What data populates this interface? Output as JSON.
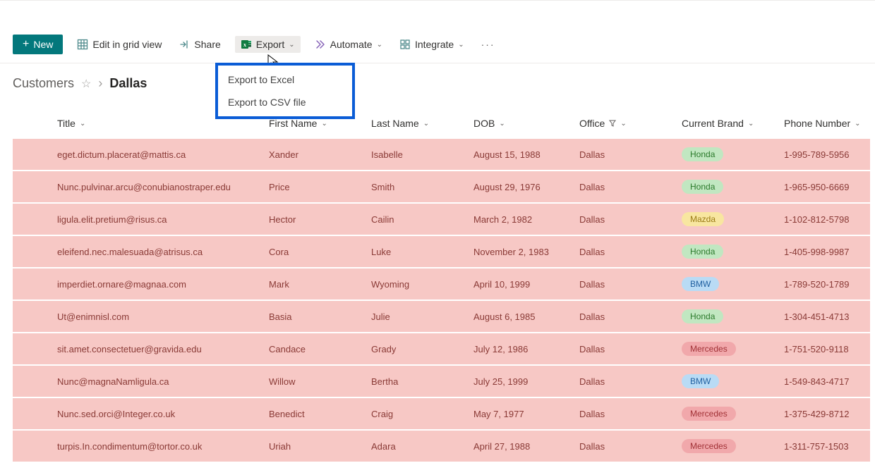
{
  "toolbar": {
    "new_label": "New",
    "edit_grid_label": "Edit in grid view",
    "share_label": "Share",
    "export_label": "Export",
    "automate_label": "Automate",
    "integrate_label": "Integrate"
  },
  "export_menu": {
    "items": [
      {
        "label": "Export to Excel"
      },
      {
        "label": "Export to CSV file"
      }
    ]
  },
  "breadcrumb": {
    "root": "Customers",
    "current": "Dallas"
  },
  "columns": {
    "title": "Title",
    "first_name": "First Name",
    "last_name": "Last Name",
    "dob": "DOB",
    "office": "Office",
    "brand": "Current Brand",
    "phone": "Phone Number"
  },
  "brand_styles": {
    "Honda": "brand-honda",
    "Mazda": "brand-mazda",
    "BMW": "brand-bmw",
    "Mercedes": "brand-mercedes"
  },
  "rows": [
    {
      "title": "eget.dictum.placerat@mattis.ca",
      "first_name": "Xander",
      "last_name": "Isabelle",
      "dob": "August 15, 1988",
      "office": "Dallas",
      "brand": "Honda",
      "phone": "1-995-789-5956"
    },
    {
      "title": "Nunc.pulvinar.arcu@conubianostraper.edu",
      "first_name": "Price",
      "last_name": "Smith",
      "dob": "August 29, 1976",
      "office": "Dallas",
      "brand": "Honda",
      "phone": "1-965-950-6669"
    },
    {
      "title": "ligula.elit.pretium@risus.ca",
      "first_name": "Hector",
      "last_name": "Cailin",
      "dob": "March 2, 1982",
      "office": "Dallas",
      "brand": "Mazda",
      "phone": "1-102-812-5798"
    },
    {
      "title": "eleifend.nec.malesuada@atrisus.ca",
      "first_name": "Cora",
      "last_name": "Luke",
      "dob": "November 2, 1983",
      "office": "Dallas",
      "brand": "Honda",
      "phone": "1-405-998-9987"
    },
    {
      "title": "imperdiet.ornare@magnaa.com",
      "first_name": "Mark",
      "last_name": "Wyoming",
      "dob": "April 10, 1999",
      "office": "Dallas",
      "brand": "BMW",
      "phone": "1-789-520-1789"
    },
    {
      "title": "Ut@enimnisl.com",
      "first_name": "Basia",
      "last_name": "Julie",
      "dob": "August 6, 1985",
      "office": "Dallas",
      "brand": "Honda",
      "phone": "1-304-451-4713"
    },
    {
      "title": "sit.amet.consectetuer@gravida.edu",
      "first_name": "Candace",
      "last_name": "Grady",
      "dob": "July 12, 1986",
      "office": "Dallas",
      "brand": "Mercedes",
      "phone": "1-751-520-9118"
    },
    {
      "title": "Nunc@magnaNamligula.ca",
      "first_name": "Willow",
      "last_name": "Bertha",
      "dob": "July 25, 1999",
      "office": "Dallas",
      "brand": "BMW",
      "phone": "1-549-843-4717"
    },
    {
      "title": "Nunc.sed.orci@Integer.co.uk",
      "first_name": "Benedict",
      "last_name": "Craig",
      "dob": "May 7, 1977",
      "office": "Dallas",
      "brand": "Mercedes",
      "phone": "1-375-429-8712"
    },
    {
      "title": "turpis.In.condimentum@tortor.co.uk",
      "first_name": "Uriah",
      "last_name": "Adara",
      "dob": "April 27, 1988",
      "office": "Dallas",
      "brand": "Mercedes",
      "phone": "1-311-757-1503"
    }
  ]
}
